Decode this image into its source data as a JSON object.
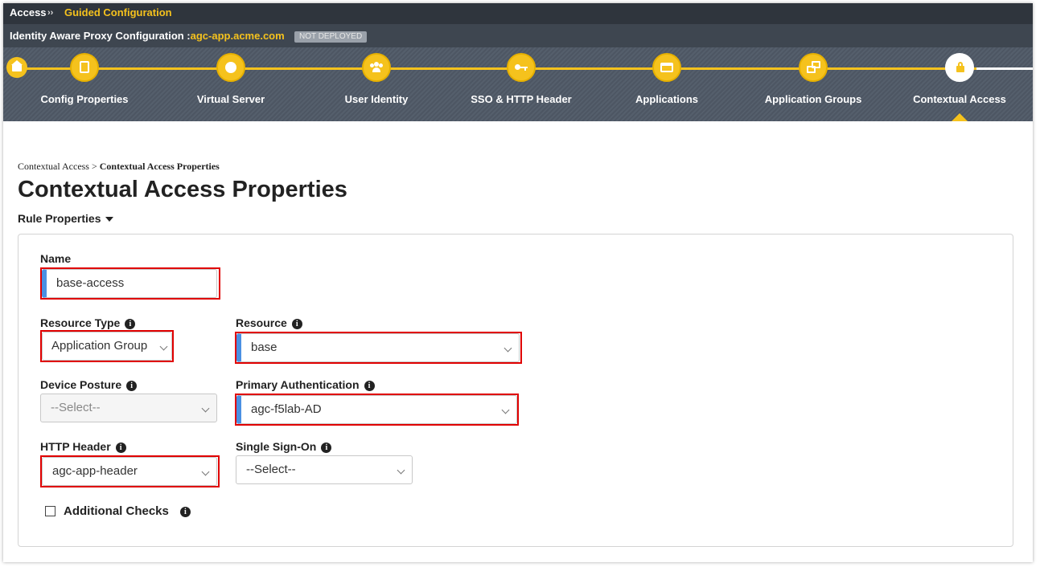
{
  "header": {
    "breadcrumb_root": "Access",
    "breadcrumb_sep": "››",
    "breadcrumb_current": "Guided Configuration",
    "config_label": "Identity Aware Proxy Configuration :",
    "config_host": "agc-app.acme.com",
    "status_badge": "NOT DEPLOYED"
  },
  "wizard": {
    "steps": [
      {
        "label": "Config Properties",
        "icon": "document-icon"
      },
      {
        "label": "Virtual Server",
        "icon": "globe-icon"
      },
      {
        "label": "User Identity",
        "icon": "users-icon"
      },
      {
        "label": "SSO & HTTP Header",
        "icon": "key-icon"
      },
      {
        "label": "Applications",
        "icon": "window-icon"
      },
      {
        "label": "Application Groups",
        "icon": "groups-icon"
      },
      {
        "label": "Contextual Access",
        "icon": "lock-icon"
      }
    ],
    "active_index": 6,
    "accent": "#f5c21d"
  },
  "page": {
    "breadcrumb_parent": "Contextual Access",
    "breadcrumb_sep": ">",
    "breadcrumb_current": "Contextual Access Properties",
    "title": "Contextual Access Properties",
    "section": "Rule Properties"
  },
  "form": {
    "name_label": "Name",
    "name_value": "base-access",
    "resource_type_label": "Resource Type",
    "resource_type_value": "Application Group",
    "resource_label": "Resource",
    "resource_value": "base",
    "device_posture_label": "Device Posture",
    "device_posture_value": "--Select--",
    "primary_auth_label": "Primary Authentication",
    "primary_auth_value": "agc-f5lab-AD",
    "http_header_label": "HTTP Header",
    "http_header_value": "agc-app-header",
    "sso_label": "Single Sign-On",
    "sso_value": "--Select--",
    "additional_checks_label": "Additional Checks",
    "info_glyph": "i"
  }
}
